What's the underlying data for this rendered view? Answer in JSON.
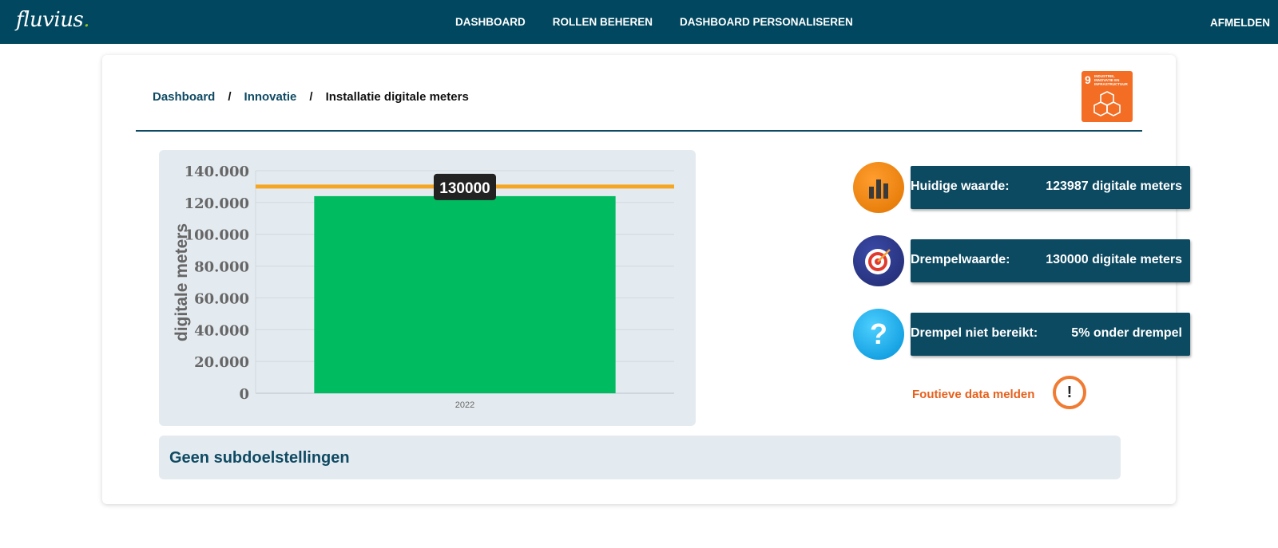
{
  "header": {
    "logo_text": "fluvius",
    "logo_dot": ".",
    "nav": [
      "DASHBOARD",
      "ROLLEN BEHEREN",
      "DASHBOARD PERSONALISEREN"
    ],
    "logout": "AFMELDEN"
  },
  "breadcrumb": {
    "items": [
      "Dashboard",
      "Innovatie"
    ],
    "separator": "/",
    "current": "Installatie digitale meters"
  },
  "sdg": {
    "number": "9",
    "label": "INDUSTRIE, INNOVATIE EN INFRASTRUCTUUR",
    "color": "#f36d25"
  },
  "chart_data": {
    "type": "bar",
    "categories": [
      "2022"
    ],
    "values": [
      123987
    ],
    "threshold": 130000,
    "threshold_label": "130000",
    "ylabel": "digitale meters",
    "ylim": [
      0,
      140000
    ],
    "yticks": [
      "0",
      "20.000",
      "40.000",
      "60.000",
      "80.000",
      "100.000",
      "120.000",
      "140.000"
    ],
    "bar_color": "#00bb5f",
    "threshold_color": "#f5a623",
    "grid": true
  },
  "stats": [
    {
      "label": "Huidige waarde:",
      "value": "123987 digitale meters",
      "icon": "bar-chart-icon"
    },
    {
      "label": "Drempelwaarde:",
      "value": "130000 digitale meters",
      "icon": "target-icon"
    },
    {
      "label": "Drempel niet bereikt:",
      "value": "5% onder drempel",
      "icon": "question-icon"
    }
  ],
  "report": {
    "label": "Foutieve data melden",
    "icon": "exclamation-icon"
  },
  "subgoals": {
    "title": "Geen subdoelstellingen"
  }
}
